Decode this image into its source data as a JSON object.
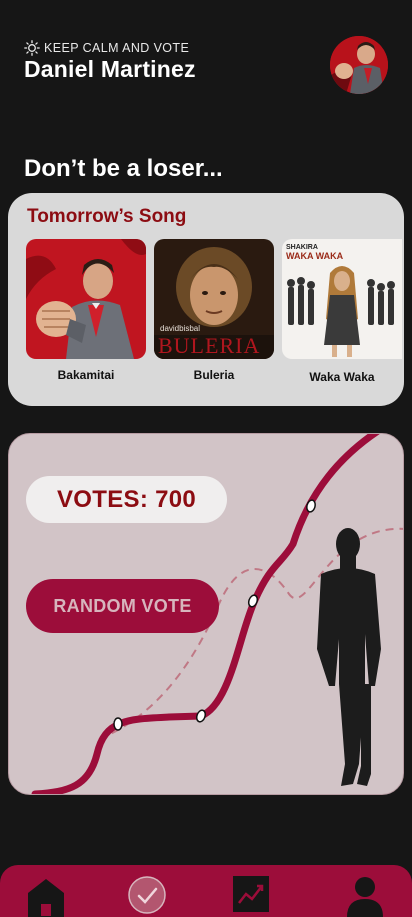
{
  "header": {
    "tagline": "KEEP CALM AND VOTE",
    "username": "Daniel Martinez",
    "avatar_icon": "user-avatar"
  },
  "slogan": "Don’t be a loser...",
  "songs_card": {
    "title": "Tomorrow’s Song",
    "songs": [
      {
        "name": "Bakamitai",
        "cover_text": ""
      },
      {
        "name": "Buleria",
        "cover_text": "davidbisbal BULERIA"
      },
      {
        "name": "Waka Waka",
        "cover_text": "SHAKIRA WAKA WAKA"
      }
    ]
  },
  "votes": {
    "label": "VOTES: 700",
    "count": 700
  },
  "random_vote_button": "RANDOM VOTE",
  "nav": [
    "home-icon",
    "vote-check-icon",
    "stats-chart-icon",
    "profile-icon"
  ],
  "colors": {
    "background": "#161616",
    "accent": "#9c0d3a",
    "title_red": "#8c0c12",
    "card_grey": "#d9d9d9",
    "vote_card": "#d2c4c7"
  }
}
